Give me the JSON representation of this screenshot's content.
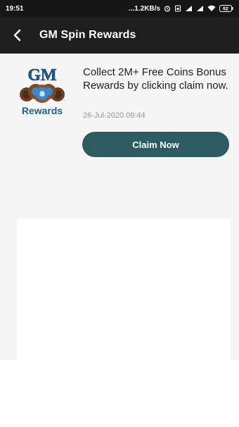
{
  "status_bar": {
    "time": "19:51",
    "network_speed": "...1.2KB/s",
    "battery": "62",
    "icons": [
      "alarm-icon",
      "sim-icon",
      "signal-icon",
      "signal-icon",
      "wifi-icon",
      "battery-icon"
    ]
  },
  "app_bar": {
    "title": "GM Spin Rewards",
    "back_icon": "back-arrow-icon"
  },
  "reward": {
    "logo_title": "GM",
    "logo_caption": "Rewards",
    "message": "Collect 2M+ Free Coins Bonus Rewards by clicking claim now.",
    "timestamp": "26-Jul-2020 09:44",
    "claim_label": "Claim Now"
  },
  "colors": {
    "status_bar": "#161616",
    "app_bar": "#1e1e1e",
    "claim_button": "#2d5b62",
    "logo_blue": "#1d5f8f",
    "coin_brown": "#6a4127"
  }
}
